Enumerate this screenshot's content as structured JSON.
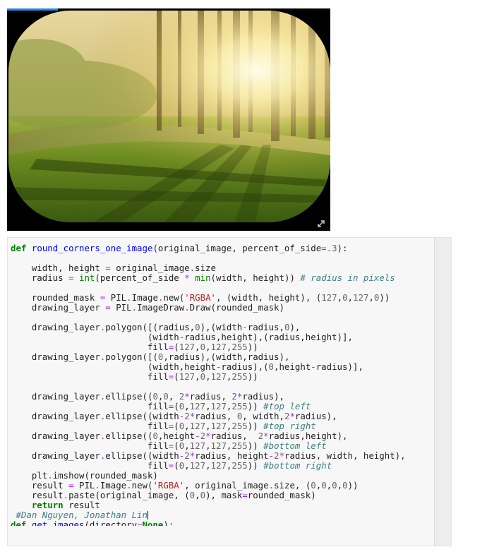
{
  "image_output": {
    "image_description": "forest-sunrise-photo-rounded-corners",
    "expand_icon": "expand-diagonal-icon",
    "accent_color": "#1e88e5"
  },
  "code_cell": {
    "lines": [
      [
        [
          "k",
          "def"
        ],
        [
          "t",
          " "
        ],
        [
          "f",
          "round_corners_one_image"
        ],
        [
          "t",
          "(original_image, percent_of_side"
        ],
        [
          "o",
          "="
        ],
        [
          "n",
          ".3"
        ],
        [
          "t",
          "):"
        ]
      ],
      [],
      [
        [
          "t",
          "    width, height "
        ],
        [
          "o",
          "="
        ],
        [
          "t",
          " original_image"
        ],
        [
          "o",
          "."
        ],
        [
          "t",
          "size"
        ]
      ],
      [
        [
          "t",
          "    radius "
        ],
        [
          "o",
          "="
        ],
        [
          "t",
          " "
        ],
        [
          "b",
          "int"
        ],
        [
          "t",
          "(percent_of_side "
        ],
        [
          "o",
          "*"
        ],
        [
          "t",
          " "
        ],
        [
          "b",
          "min"
        ],
        [
          "t",
          "(width, height)) "
        ],
        [
          "c",
          "# radius in pixels"
        ]
      ],
      [],
      [
        [
          "t",
          "    rounded_mask "
        ],
        [
          "o",
          "="
        ],
        [
          "t",
          " PIL"
        ],
        [
          "o",
          "."
        ],
        [
          "t",
          "Image"
        ],
        [
          "o",
          "."
        ],
        [
          "t",
          "new("
        ],
        [
          "s",
          "'RGBA'"
        ],
        [
          "t",
          ", (width, height), ("
        ],
        [
          "n",
          "127"
        ],
        [
          "t",
          ","
        ],
        [
          "n",
          "0"
        ],
        [
          "t",
          ","
        ],
        [
          "n",
          "127"
        ],
        [
          "t",
          ","
        ],
        [
          "n",
          "0"
        ],
        [
          "t",
          "))"
        ]
      ],
      [
        [
          "t",
          "    drawing_layer "
        ],
        [
          "o",
          "="
        ],
        [
          "t",
          " PIL"
        ],
        [
          "o",
          "."
        ],
        [
          "t",
          "ImageDraw"
        ],
        [
          "o",
          "."
        ],
        [
          "t",
          "Draw(rounded_mask)"
        ]
      ],
      [],
      [
        [
          "t",
          "    drawing_layer"
        ],
        [
          "o",
          "."
        ],
        [
          "t",
          "polygon([(radius,"
        ],
        [
          "n",
          "0"
        ],
        [
          "t",
          "),(width"
        ],
        [
          "o",
          "-"
        ],
        [
          "t",
          "radius,"
        ],
        [
          "n",
          "0"
        ],
        [
          "t",
          "),"
        ]
      ],
      [
        [
          "t",
          "                          (width"
        ],
        [
          "o",
          "-"
        ],
        [
          "t",
          "radius,height),(radius,height)],"
        ]
      ],
      [
        [
          "t",
          "                          fill"
        ],
        [
          "o",
          "="
        ],
        [
          "t",
          "("
        ],
        [
          "n",
          "127"
        ],
        [
          "t",
          ","
        ],
        [
          "n",
          "0"
        ],
        [
          "t",
          ","
        ],
        [
          "n",
          "127"
        ],
        [
          "t",
          ","
        ],
        [
          "n",
          "255"
        ],
        [
          "t",
          "))"
        ]
      ],
      [
        [
          "t",
          "    drawing_layer"
        ],
        [
          "o",
          "."
        ],
        [
          "t",
          "polygon([("
        ],
        [
          "n",
          "0"
        ],
        [
          "t",
          ",radius),(width,radius),"
        ]
      ],
      [
        [
          "t",
          "                          (width,height"
        ],
        [
          "o",
          "-"
        ],
        [
          "t",
          "radius),("
        ],
        [
          "n",
          "0"
        ],
        [
          "t",
          ",height"
        ],
        [
          "o",
          "-"
        ],
        [
          "t",
          "radius)],"
        ]
      ],
      [
        [
          "t",
          "                          fill"
        ],
        [
          "o",
          "="
        ],
        [
          "t",
          "("
        ],
        [
          "n",
          "127"
        ],
        [
          "t",
          ","
        ],
        [
          "n",
          "0"
        ],
        [
          "t",
          ","
        ],
        [
          "n",
          "127"
        ],
        [
          "t",
          ","
        ],
        [
          "n",
          "255"
        ],
        [
          "t",
          "))"
        ]
      ],
      [],
      [
        [
          "t",
          "    drawing_layer"
        ],
        [
          "o",
          "."
        ],
        [
          "t",
          "ellipse(("
        ],
        [
          "n",
          "0"
        ],
        [
          "t",
          ","
        ],
        [
          "n",
          "0"
        ],
        [
          "t",
          ", "
        ],
        [
          "n",
          "2"
        ],
        [
          "o",
          "*"
        ],
        [
          "t",
          "radius, "
        ],
        [
          "n",
          "2"
        ],
        [
          "o",
          "*"
        ],
        [
          "t",
          "radius),"
        ]
      ],
      [
        [
          "t",
          "                          fill"
        ],
        [
          "o",
          "="
        ],
        [
          "t",
          "("
        ],
        [
          "n",
          "0"
        ],
        [
          "t",
          ","
        ],
        [
          "n",
          "127"
        ],
        [
          "t",
          ","
        ],
        [
          "n",
          "127"
        ],
        [
          "t",
          ","
        ],
        [
          "n",
          "255"
        ],
        [
          "t",
          ")) "
        ],
        [
          "c",
          "#top left"
        ]
      ],
      [
        [
          "t",
          "    drawing_layer"
        ],
        [
          "o",
          "."
        ],
        [
          "t",
          "ellipse((width"
        ],
        [
          "o",
          "-"
        ],
        [
          "n",
          "2"
        ],
        [
          "o",
          "*"
        ],
        [
          "t",
          "radius, "
        ],
        [
          "n",
          "0"
        ],
        [
          "t",
          ", width,"
        ],
        [
          "n",
          "2"
        ],
        [
          "o",
          "*"
        ],
        [
          "t",
          "radius),"
        ]
      ],
      [
        [
          "t",
          "                          fill"
        ],
        [
          "o",
          "="
        ],
        [
          "t",
          "("
        ],
        [
          "n",
          "0"
        ],
        [
          "t",
          ","
        ],
        [
          "n",
          "127"
        ],
        [
          "t",
          ","
        ],
        [
          "n",
          "127"
        ],
        [
          "t",
          ","
        ],
        [
          "n",
          "255"
        ],
        [
          "t",
          ")) "
        ],
        [
          "c",
          "#top right"
        ]
      ],
      [
        [
          "t",
          "    drawing_layer"
        ],
        [
          "o",
          "."
        ],
        [
          "t",
          "ellipse(("
        ],
        [
          "n",
          "0"
        ],
        [
          "t",
          ",height"
        ],
        [
          "o",
          "-"
        ],
        [
          "n",
          "2"
        ],
        [
          "o",
          "*"
        ],
        [
          "t",
          "radius,  "
        ],
        [
          "n",
          "2"
        ],
        [
          "o",
          "*"
        ],
        [
          "t",
          "radius,height),"
        ]
      ],
      [
        [
          "t",
          "                          fill"
        ],
        [
          "o",
          "="
        ],
        [
          "t",
          "("
        ],
        [
          "n",
          "0"
        ],
        [
          "t",
          ","
        ],
        [
          "n",
          "127"
        ],
        [
          "t",
          ","
        ],
        [
          "n",
          "127"
        ],
        [
          "t",
          ","
        ],
        [
          "n",
          "255"
        ],
        [
          "t",
          ")) "
        ],
        [
          "c",
          "#bottom left"
        ]
      ],
      [
        [
          "t",
          "    drawing_layer"
        ],
        [
          "o",
          "."
        ],
        [
          "t",
          "ellipse((width"
        ],
        [
          "o",
          "-"
        ],
        [
          "n",
          "2"
        ],
        [
          "o",
          "*"
        ],
        [
          "t",
          "radius, height"
        ],
        [
          "o",
          "-"
        ],
        [
          "n",
          "2"
        ],
        [
          "o",
          "*"
        ],
        [
          "t",
          "radius, width, height),"
        ]
      ],
      [
        [
          "t",
          "                          fill"
        ],
        [
          "o",
          "="
        ],
        [
          "t",
          "("
        ],
        [
          "n",
          "0"
        ],
        [
          "t",
          ","
        ],
        [
          "n",
          "127"
        ],
        [
          "t",
          ","
        ],
        [
          "n",
          "127"
        ],
        [
          "t",
          ","
        ],
        [
          "n",
          "255"
        ],
        [
          "t",
          ")) "
        ],
        [
          "c",
          "#bottom right"
        ]
      ],
      [
        [
          "t",
          "    plt"
        ],
        [
          "o",
          "."
        ],
        [
          "t",
          "imshow(rounded_mask)"
        ]
      ],
      [
        [
          "t",
          "    result "
        ],
        [
          "o",
          "="
        ],
        [
          "t",
          " PIL"
        ],
        [
          "o",
          "."
        ],
        [
          "t",
          "Image"
        ],
        [
          "o",
          "."
        ],
        [
          "t",
          "new("
        ],
        [
          "s",
          "'RGBA'"
        ],
        [
          "t",
          ", original_image"
        ],
        [
          "o",
          "."
        ],
        [
          "t",
          "size, ("
        ],
        [
          "n",
          "0"
        ],
        [
          "t",
          ","
        ],
        [
          "n",
          "0"
        ],
        [
          "t",
          ","
        ],
        [
          "n",
          "0"
        ],
        [
          "t",
          ","
        ],
        [
          "n",
          "0"
        ],
        [
          "t",
          "))"
        ]
      ],
      [
        [
          "t",
          "    result"
        ],
        [
          "o",
          "."
        ],
        [
          "t",
          "paste(original_image, ("
        ],
        [
          "n",
          "0"
        ],
        [
          "t",
          ","
        ],
        [
          "n",
          "0"
        ],
        [
          "t",
          "), mask"
        ],
        [
          "o",
          "="
        ],
        [
          "t",
          "rounded_mask)"
        ]
      ],
      [
        [
          "t",
          "    "
        ],
        [
          "k",
          "return"
        ],
        [
          "t",
          " result"
        ]
      ],
      [
        [
          "t",
          " "
        ],
        [
          "c",
          "#Dan Nguyen, Jonathan Lin"
        ],
        [
          "cursor",
          ""
        ]
      ],
      [
        [
          "k",
          "def"
        ],
        [
          "t",
          " "
        ],
        [
          "f",
          "get_images"
        ],
        [
          "t",
          "(directory"
        ],
        [
          "o",
          "="
        ],
        [
          "k",
          "None"
        ],
        [
          "t",
          "):"
        ]
      ]
    ]
  }
}
